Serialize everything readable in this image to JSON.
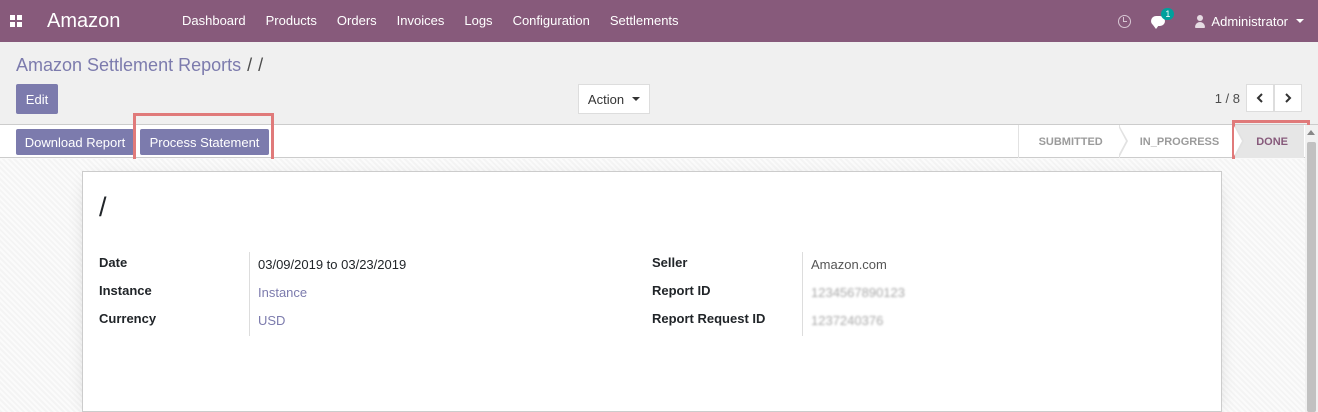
{
  "navbar": {
    "brand": "Amazon",
    "menu": [
      "Dashboard",
      "Products",
      "Orders",
      "Invoices",
      "Logs",
      "Configuration",
      "Settlements"
    ],
    "chat_count": "1",
    "user": "Administrator"
  },
  "control_panel": {
    "breadcrumb_parent": "Amazon Settlement Reports",
    "breadcrumb_separator": "/",
    "breadcrumb_current": "/",
    "edit_label": "Edit",
    "action_label": "Action",
    "pager": "1 / 8"
  },
  "statusbar": {
    "download_label": "Download Report",
    "process_label": "Process Statement",
    "stages": [
      "SUBMITTED",
      "IN_PROGRESS",
      "DONE"
    ],
    "active_stage": "DONE"
  },
  "form": {
    "name": "/",
    "left": [
      {
        "label": "Date",
        "value": "03/09/2019 to 03/23/2019"
      },
      {
        "label": "Instance",
        "value": "Instance"
      },
      {
        "label": "Currency",
        "value": "USD"
      }
    ],
    "right": [
      {
        "label": "Seller",
        "value": "Amazon.com"
      },
      {
        "label": "Report ID",
        "value": "1234567890123"
      },
      {
        "label": "Report Request ID",
        "value": "1237240376"
      }
    ]
  },
  "colors": {
    "navbar": "#875a7b",
    "primary": "#7c7bad",
    "highlight": "#e07a7a"
  }
}
